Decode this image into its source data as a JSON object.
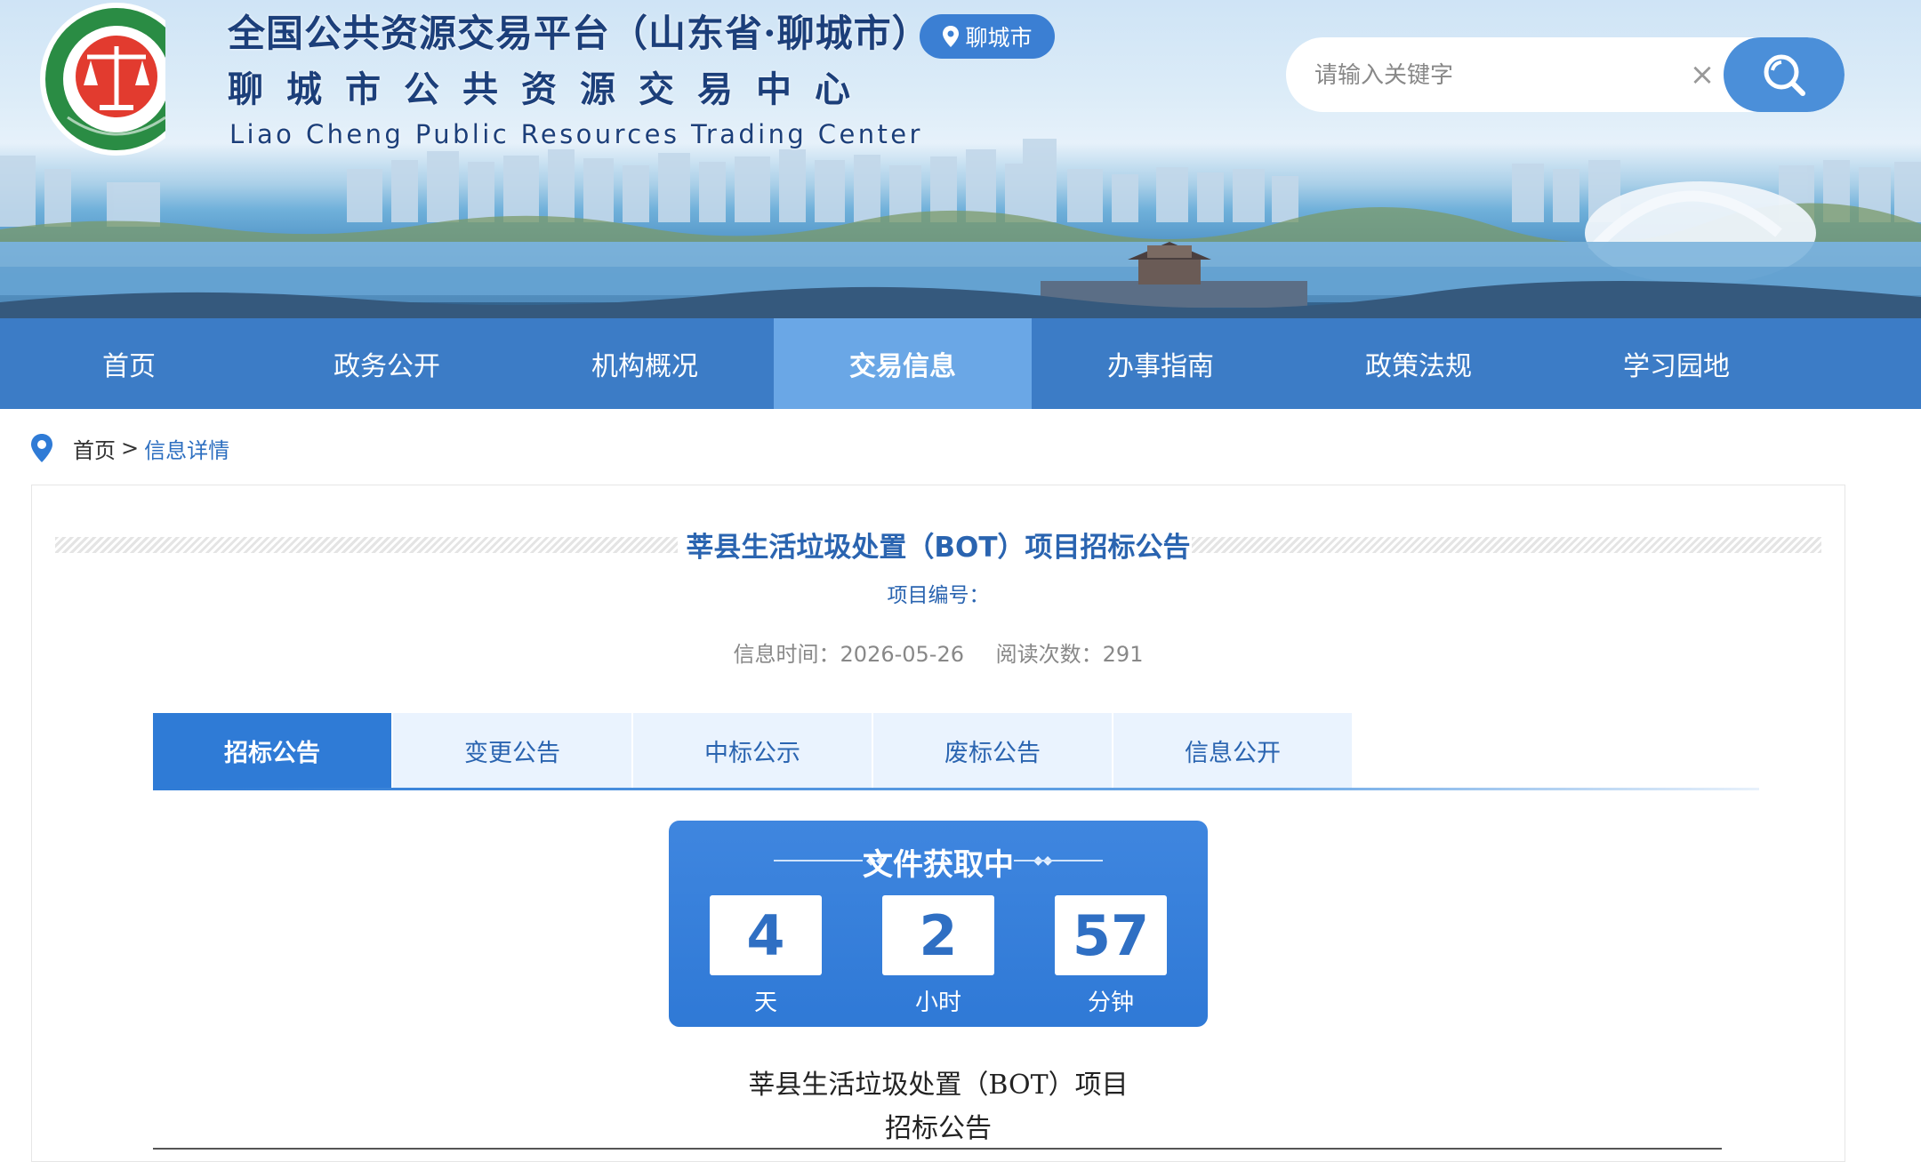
{
  "header": {
    "title_line1": "全国公共资源交易平台（山东省·聊城市）",
    "title_line2": "聊城市公共资源交易中心",
    "title_en": "Liao Cheng Public Resources Trading Center",
    "city": "聊城市"
  },
  "search": {
    "placeholder": "请输入关键字",
    "value": "",
    "clear_label": "×"
  },
  "nav": {
    "items": [
      {
        "label": "首页"
      },
      {
        "label": "政务公开"
      },
      {
        "label": "机构概况"
      },
      {
        "label": "交易信息"
      },
      {
        "label": "办事指南"
      },
      {
        "label": "政策法规"
      },
      {
        "label": "学习园地"
      }
    ],
    "active_index": 3
  },
  "breadcrumb": {
    "home": "首页",
    "separator": ">",
    "current": "信息详情"
  },
  "article": {
    "title": "莘县生活垃圾处置（BOT）项目招标公告",
    "project_no_label": "项目编号：",
    "info_time": "信息时间：2026-05-26",
    "read_count": "阅读次数：291"
  },
  "tabs": {
    "items": [
      {
        "label": "招标公告"
      },
      {
        "label": "变更公告"
      },
      {
        "label": "中标公示"
      },
      {
        "label": "废标公告"
      },
      {
        "label": "信息公开"
      }
    ],
    "active_index": 0
  },
  "countdown": {
    "title": "文件获取中",
    "days": "4",
    "days_unit": "天",
    "hours": "2",
    "hours_unit": "小时",
    "minutes": "57",
    "minutes_unit": "分钟"
  },
  "body": {
    "heading_line1": "莘县生活垃圾处置（BOT）项目",
    "heading_line2": "招标公告"
  },
  "colors": {
    "nav_bg": "#3c7cc6",
    "nav_active": "#6aa7e6",
    "accent": "#2f7bd6",
    "title_blue": "#2a64b0"
  },
  "icons": {
    "logo": "scales-emblem-logo",
    "city": "location-pin-icon",
    "search": "search-icon",
    "breadcrumb": "location-pin-icon"
  }
}
